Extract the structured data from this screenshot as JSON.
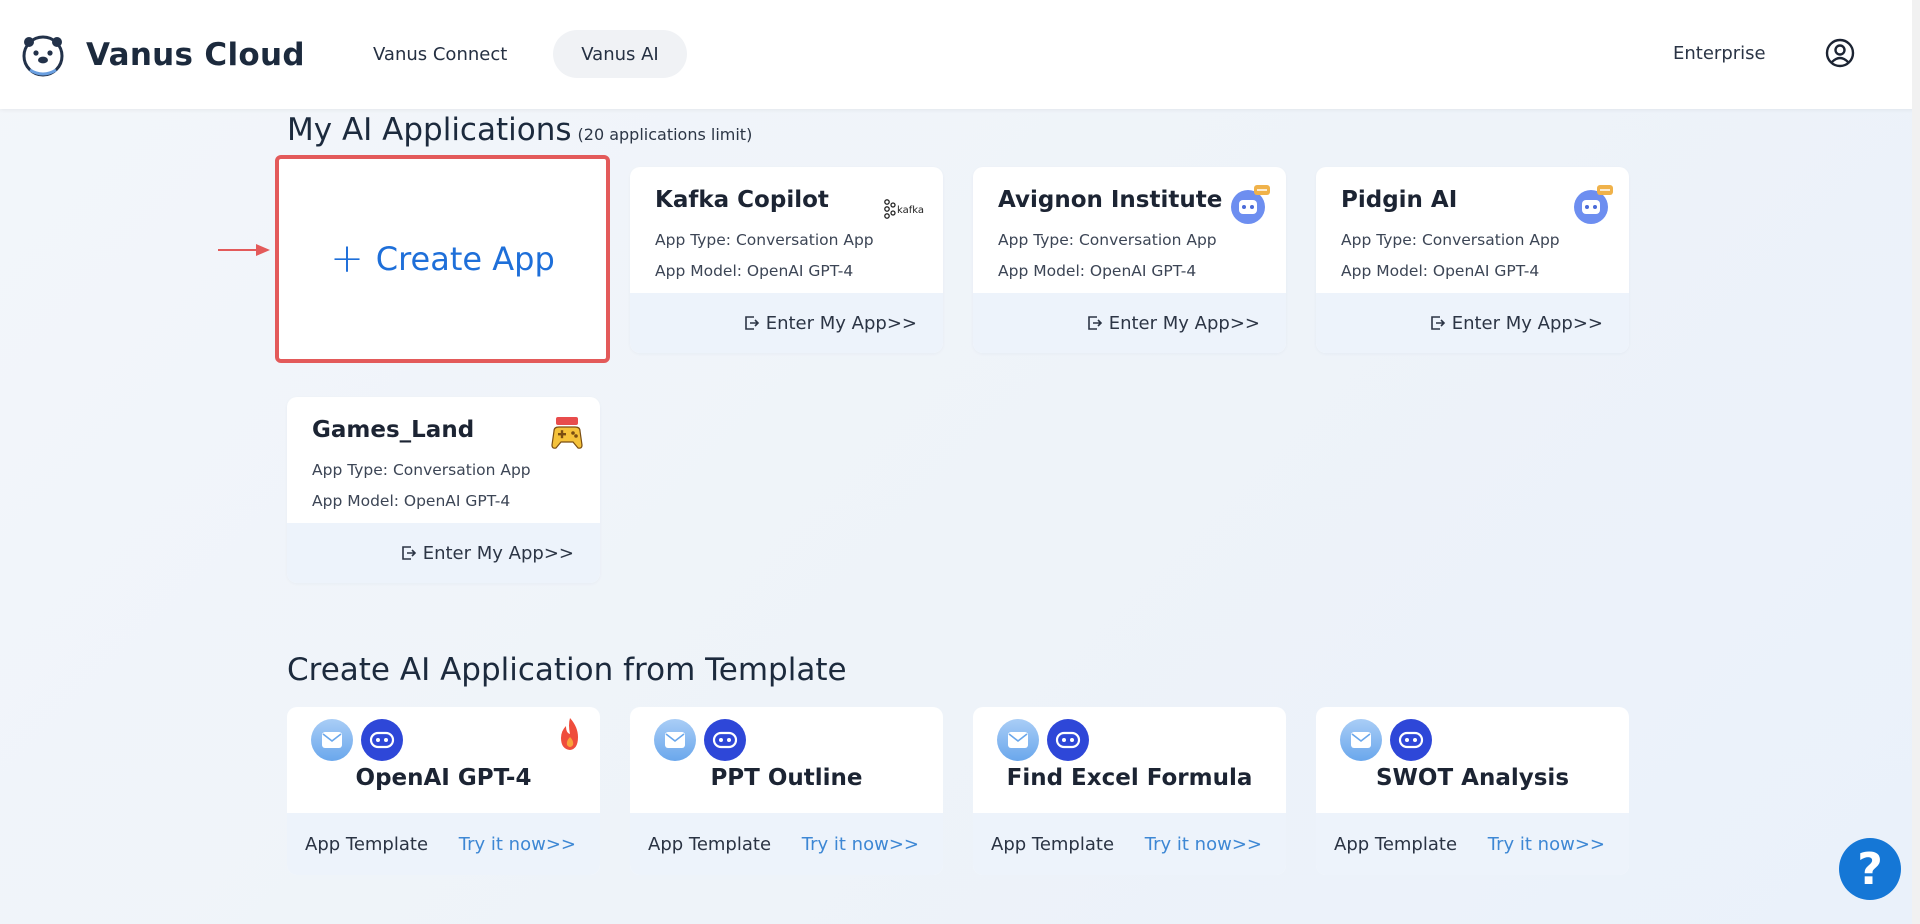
{
  "header": {
    "brand_name": "Vanus Cloud",
    "nav": [
      {
        "label": "Vanus Connect"
      },
      {
        "label": "Vanus AI"
      }
    ],
    "enterprise": "Enterprise"
  },
  "my_apps": {
    "title": "My AI Applications",
    "limit": "(20 applications limit)",
    "create_label": "Create App",
    "items": [
      {
        "title": "Kafka Copilot",
        "type": "App Type: Conversation App",
        "model": "App Model: OpenAI GPT-4",
        "enter": "Enter My App>>",
        "logo_text": "kafka"
      },
      {
        "title": "Avignon Institute",
        "type": "App Type: Conversation App",
        "model": "App Model: OpenAI GPT-4",
        "enter": "Enter My App>>"
      },
      {
        "title": "Pidgin AI",
        "type": "App Type: Conversation App",
        "model": "App Model: OpenAI GPT-4",
        "enter": "Enter My App>>"
      },
      {
        "title": "Games_Land",
        "type": "App Type: Conversation App",
        "model": "App Model: OpenAI GPT-4",
        "enter": "Enter My App>>"
      }
    ]
  },
  "templates": {
    "title": "Create AI Application from Template",
    "items": [
      {
        "title": "OpenAI GPT-4",
        "label": "App Template",
        "try": "Try it now>>"
      },
      {
        "title": "PPT Outline",
        "label": "App Template",
        "try": "Try it now>>"
      },
      {
        "title": "Find Excel Formula",
        "label": "App Template",
        "try": "Try it now>>"
      },
      {
        "title": "SWOT Analysis",
        "label": "App Template",
        "try": "Try it now>>"
      }
    ]
  },
  "help": {
    "symbol": "?"
  },
  "colors": {
    "accent": "#1e6fd9",
    "highlight_border": "#e35a5a",
    "card_footer": "#edf3fb",
    "try_link": "#3d87d4",
    "bot_icon": "#2e47d8"
  }
}
